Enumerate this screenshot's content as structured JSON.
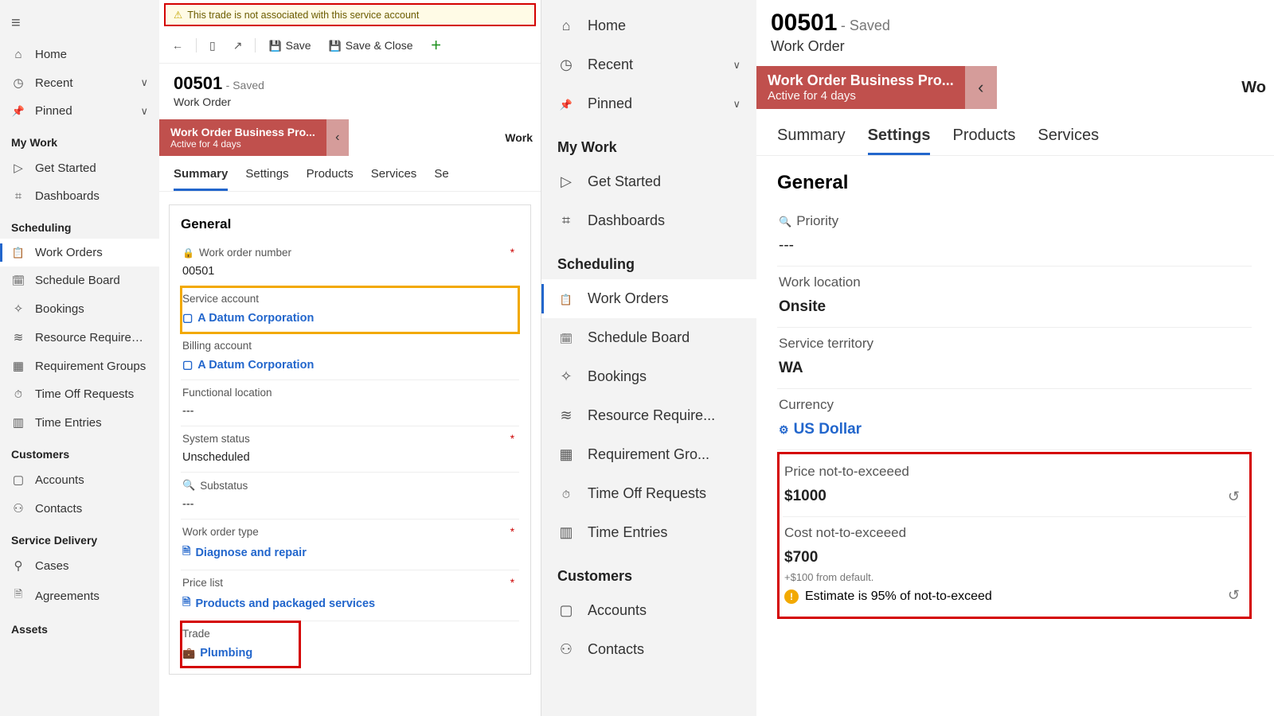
{
  "left": {
    "warning": "This trade is not associated with this service account",
    "sidebar": {
      "home": "Home",
      "recent": "Recent",
      "pinned": "Pinned",
      "sec_mywork": "My Work",
      "getstarted": "Get Started",
      "dashboards": "Dashboards",
      "sec_sched": "Scheduling",
      "workorders": "Work Orders",
      "schedboard": "Schedule Board",
      "bookings": "Bookings",
      "resreq": "Resource Requireme...",
      "reqgrp": "Requirement Groups",
      "timeoff": "Time Off Requests",
      "timeent": "Time Entries",
      "sec_cust": "Customers",
      "accounts": "Accounts",
      "contacts": "Contacts",
      "sec_svc": "Service Delivery",
      "cases": "Cases",
      "agreements": "Agreements",
      "sec_assets": "Assets"
    },
    "toolbar": {
      "save": "Save",
      "saveclose": "Save & Close",
      "new": "+"
    },
    "record": {
      "id": "00501",
      "state": "- Saved",
      "sub": "Work Order"
    },
    "bpf": {
      "title": "Work Order Business Pro...",
      "sub": "Active for 4 days",
      "stage": "Work"
    },
    "tabs": {
      "summary": "Summary",
      "settings": "Settings",
      "products": "Products",
      "services": "Services",
      "more": "Se"
    },
    "form": {
      "section": "General",
      "f1": {
        "label": "Work order number",
        "value": "00501",
        "required": true
      },
      "f2": {
        "label": "Service account",
        "value": "A Datum Corporation"
      },
      "f3": {
        "label": "Billing account",
        "value": "A Datum Corporation"
      },
      "f4": {
        "label": "Functional location",
        "value": "---"
      },
      "f5": {
        "label": "System status",
        "value": "Unscheduled",
        "required": true
      },
      "f6": {
        "label": "Substatus",
        "value": "---"
      },
      "f7": {
        "label": "Work order type",
        "value": "Diagnose and repair",
        "required": true
      },
      "f8": {
        "label": "Price list",
        "value": "Products and packaged services",
        "required": true
      },
      "f9": {
        "label": "Trade",
        "value": "Plumbing"
      }
    }
  },
  "right": {
    "sidebar": {
      "home": "Home",
      "recent": "Recent",
      "pinned": "Pinned",
      "sec_mywork": "My Work",
      "getstarted": "Get Started",
      "dashboards": "Dashboards",
      "sec_sched": "Scheduling",
      "workorders": "Work Orders",
      "schedboard": "Schedule Board",
      "bookings": "Bookings",
      "resreq": "Resource Require...",
      "reqgrp": "Requirement Gro...",
      "timeoff": "Time Off Requests",
      "timeent": "Time Entries",
      "sec_cust": "Customers",
      "accounts": "Accounts",
      "contacts": "Contacts"
    },
    "record": {
      "id": "00501",
      "state": "- Saved",
      "sub": "Work Order"
    },
    "bpf": {
      "title": "Work Order Business Pro...",
      "sub": "Active for 4 days",
      "stage": "Wo"
    },
    "tabs": {
      "summary": "Summary",
      "settings": "Settings",
      "products": "Products",
      "services": "Services"
    },
    "form": {
      "section": "General",
      "f1": {
        "label": "Priority",
        "value": "---"
      },
      "f2": {
        "label": "Work location",
        "value": "Onsite"
      },
      "f3": {
        "label": "Service territory",
        "value": "WA"
      },
      "f4": {
        "label": "Currency",
        "value": "US Dollar"
      },
      "f5": {
        "label": "Price not-to-exceeed",
        "value": "$1000"
      },
      "f6": {
        "label": "Cost not-to-exceeed",
        "value": "$700",
        "hint": "+$100 from default.",
        "warn": "Estimate is 95% of not-to-exceed"
      }
    }
  }
}
